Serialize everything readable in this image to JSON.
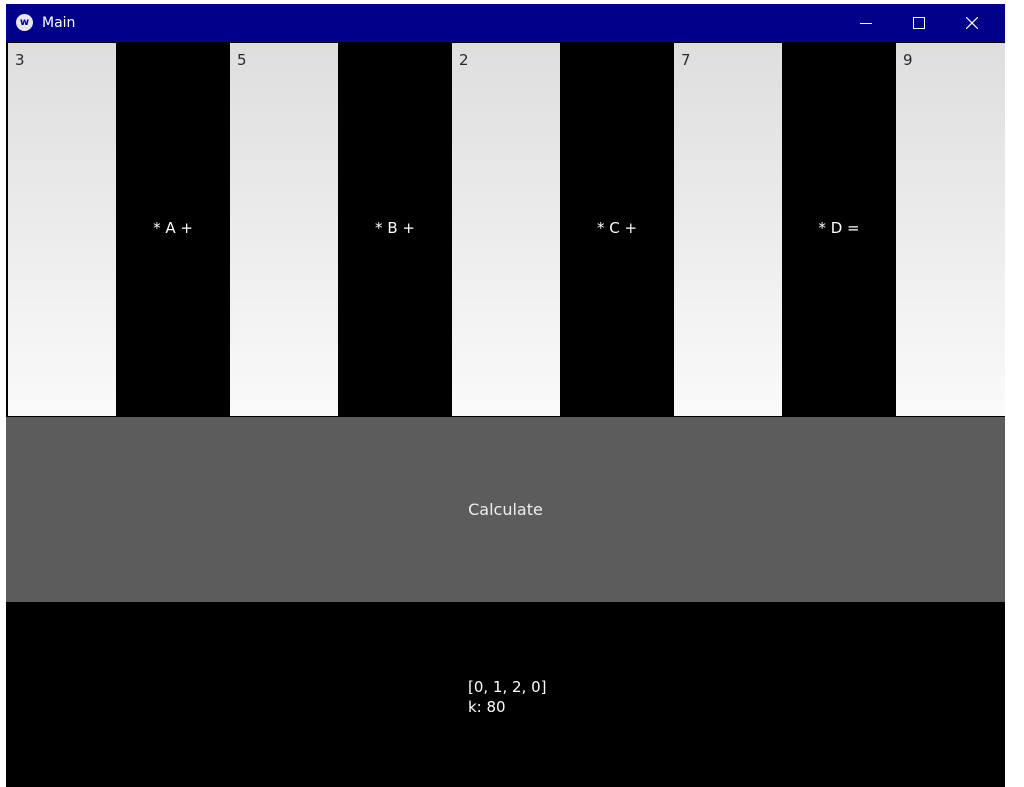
{
  "window": {
    "title": "Main",
    "icon": "kivy-logo-icon",
    "icon_glyph": "w",
    "controls": [
      "minimize-icon",
      "maximize-icon",
      "close-icon"
    ],
    "titlebar_color": "#00008b"
  },
  "keys": [
    {
      "type": "white",
      "label": "3"
    },
    {
      "type": "black",
      "label": "* A +"
    },
    {
      "type": "white",
      "label": "5"
    },
    {
      "type": "black",
      "label": "* B +"
    },
    {
      "type": "white",
      "label": "2"
    },
    {
      "type": "black",
      "label": "* C +"
    },
    {
      "type": "white",
      "label": "7"
    },
    {
      "type": "black",
      "label": "* D ="
    },
    {
      "type": "white",
      "label": "9"
    }
  ],
  "calculate": {
    "label": "Calculate",
    "color": "#5c5c5c"
  },
  "output": {
    "lines": [
      "[0, 1, 2, 0]",
      "k: 80"
    ]
  }
}
